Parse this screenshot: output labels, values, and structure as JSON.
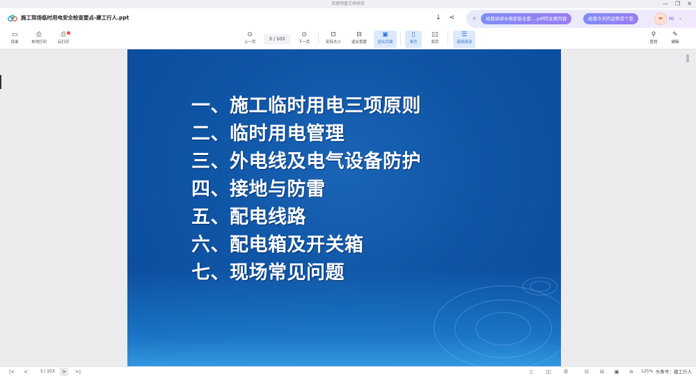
{
  "window": {
    "app_title": "百度网盘文档预览",
    "controls": {
      "minimize": "—",
      "restore": "❐",
      "close": "✕"
    }
  },
  "header": {
    "doc_title": "施工现场临时用电安全检查要点-建工行人.ppt",
    "download_icon": "↓",
    "share_icon": "⋖"
  },
  "ai_bar": {
    "close": "×",
    "chip1": "给我讲讲水电安装全套....pdf的主要内容",
    "chip2": "给我今天的运势求个签",
    "greeting": "Hi",
    "chevron": "›"
  },
  "toolbar": {
    "toc": {
      "icon": "▭",
      "label": "目录"
    },
    "local_print": {
      "icon": "⎙",
      "label": "本地打印"
    },
    "cloud_print": {
      "icon": "⎙",
      "label": "云打印"
    },
    "prev": {
      "icon": "⊙",
      "label": "上一页"
    },
    "page_current": "3",
    "page_total": "103",
    "next": {
      "icon": "⊙",
      "label": "下一页"
    },
    "actual_size": {
      "icon": "⊡",
      "label": "实际大小"
    },
    "fit_width": {
      "icon": "⊟",
      "label": "适合宽度"
    },
    "fit_page": {
      "icon": "▣",
      "label": "适合页面"
    },
    "single": {
      "icon": "▯",
      "label": "单页"
    },
    "double": {
      "icon": "▯▯",
      "label": "双页"
    },
    "continuous": {
      "icon": "☰",
      "label": "连续阅读"
    },
    "search": {
      "icon": "⚲",
      "label": "查找"
    },
    "edit": {
      "icon": "✎",
      "label": "编辑"
    }
  },
  "slide": {
    "items": [
      "一、施工临时用电三项原则",
      "二、临时用电管理",
      "三、外电线及电气设备防护",
      "四、接地与防雷",
      "五、配电线路",
      "六、配电箱及开关箱",
      "七、现场常见问题"
    ]
  },
  "statusbar": {
    "first": "|<",
    "prev": "<",
    "page": "3 / 103",
    "next": ">",
    "last": ">|",
    "zoom": "125%",
    "watermark": "头条号：建工行人"
  },
  "colors": {
    "accent": "#2f6fdc",
    "slide_bg": "#0f55a6",
    "ai_chip": "#8a84f3"
  }
}
